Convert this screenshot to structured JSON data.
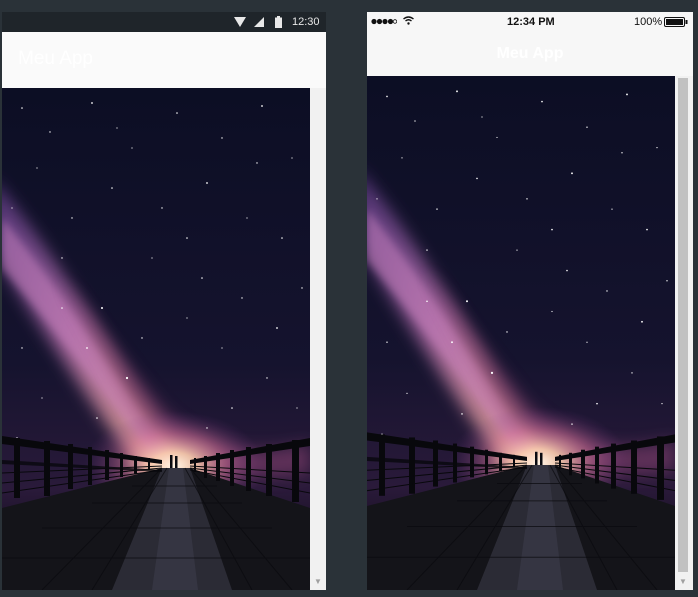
{
  "android": {
    "status": {
      "time": "12:30"
    },
    "app_title": "Meu App"
  },
  "ios": {
    "status": {
      "time": "12:34 PM",
      "battery": "100%"
    },
    "app_title": "Meu App"
  },
  "colors": {
    "sky_top": "#0c0e24",
    "milky_way": "#b86aa8",
    "glow": "#ffe2c8",
    "bridge": "#0a0a10"
  }
}
